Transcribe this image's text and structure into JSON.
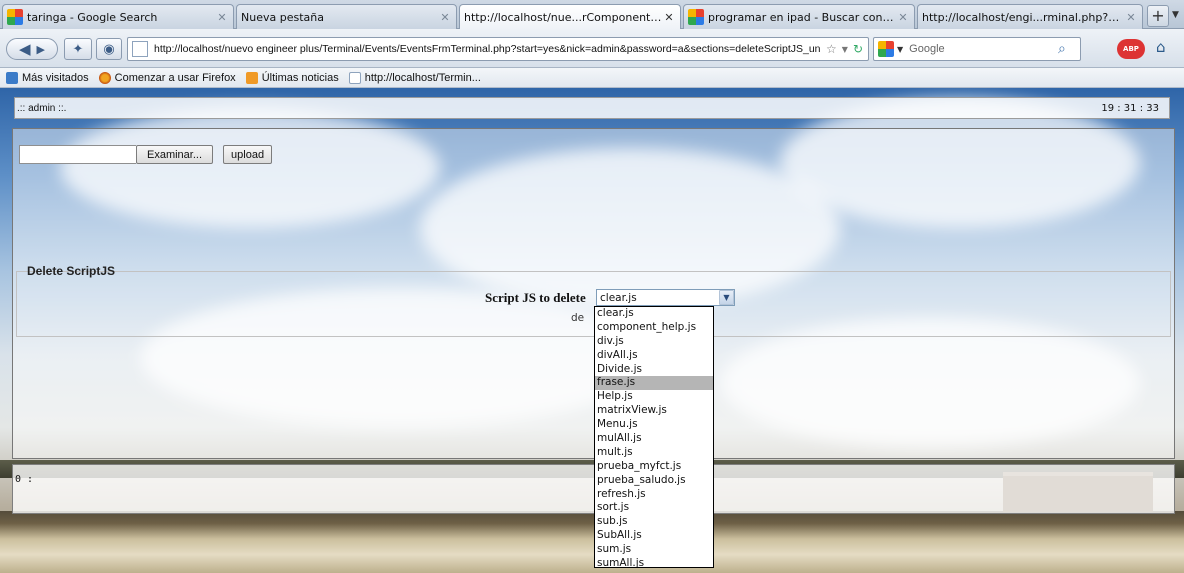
{
  "browser": {
    "tabs": [
      {
        "label": "taringa - Google Search",
        "icon": "google-icon",
        "active": false
      },
      {
        "label": "Nueva pestaña",
        "icon": "page-icon",
        "active": false
      },
      {
        "label": "http://localhost/nue...rComponent_terminal",
        "icon": "page-icon",
        "active": true
      },
      {
        "label": "programar en ipad - Buscar con Google",
        "icon": "google-icon",
        "active": false
      },
      {
        "label": "http://localhost/engi...rminal.php?start=yes",
        "icon": "page-icon",
        "active": false
      }
    ],
    "new_tab": "+",
    "url": "http://localhost/nuevo engineer plus/Terminal/Events/EventsFrmTerminal.php?start=yes&nick=admin&password=a&sections=deleteScriptJS_unRegiste",
    "search_placeholder": "Google",
    "bookmarks": [
      {
        "label": "Más visitados",
        "icon": "bookmarks-icon"
      },
      {
        "label": "Comenzar a usar Firefox",
        "icon": "firefox-icon"
      },
      {
        "label": "Últimas noticias",
        "icon": "rss-icon"
      },
      {
        "label": "http://localhost/Termin...",
        "icon": "page-icon"
      }
    ]
  },
  "page": {
    "user_label": ".:: admin ::.",
    "clock": "19 : 31 : 33",
    "browse_button": "Examinar...",
    "upload_button": "upload",
    "section_legend": "Delete ScriptJS",
    "select_label": "Script JS to delete",
    "selected_value": "clear.js",
    "delete_fragment": "de",
    "output": "0 :",
    "options": [
      "clear.js",
      "component_help.js",
      "div.js",
      "divAll.js",
      "Divide.js",
      "frase.js",
      "Help.js",
      "matrixView.js",
      "Menu.js",
      "mulAll.js",
      "mult.js",
      "prueba_myfct.js",
      "prueba_saludo.js",
      "refresh.js",
      "sort.js",
      "sub.js",
      "SubAll.js",
      "sum.js",
      "sumAll.js"
    ],
    "highlighted_option": "frase.js"
  }
}
